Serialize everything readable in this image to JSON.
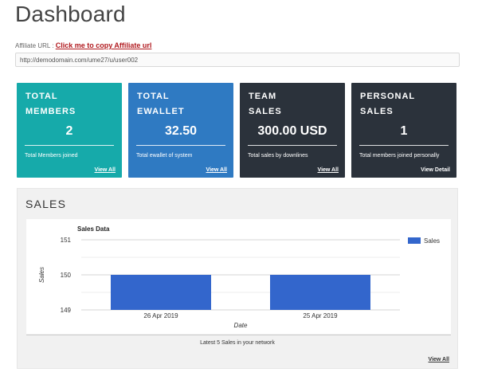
{
  "header": {
    "title": "Dashboard"
  },
  "affiliate": {
    "label": "Affiliate URL :",
    "copy_link": "Click me to copy Affiliate url",
    "url_value": "http://demodomain.com/ume27/u/user002"
  },
  "cards": [
    {
      "title_line1": "TOTAL",
      "title_line2": "MEMBERS",
      "value": "2",
      "desc": "Total Members joined",
      "link": "View All",
      "color": "#16aaaa"
    },
    {
      "title_line1": "TOTAL",
      "title_line2": "EWALLET",
      "value": "32.50",
      "desc": "Total ewallet of system",
      "link": "View All",
      "color": "#2f7ac2"
    },
    {
      "title_line1": "TEAM",
      "title_line2": "SALES",
      "value": "300.00 USD",
      "desc": "Total sales by downlines",
      "link": "View All",
      "color": "#2b323b"
    },
    {
      "title_line1": "PERSONAL",
      "title_line2": "SALES",
      "value": "1",
      "desc": "Total members joined personally",
      "link": "View Detail",
      "color": "#2b323b"
    }
  ],
  "sales_panel": {
    "heading": "SALES",
    "caption": "Latest 5 Sales in your network",
    "link": "View All"
  },
  "chart_data": {
    "type": "bar",
    "title": "Sales Data",
    "xlabel": "Date",
    "ylabel": "Sales",
    "categories": [
      "26 Apr 2019",
      "25 Apr 2019"
    ],
    "series": [
      {
        "name": "Sales",
        "values": [
          150,
          150
        ],
        "color": "#3366cc"
      }
    ],
    "ylim": [
      149,
      151
    ],
    "yticks": [
      "149",
      "150",
      "151"
    ],
    "legend": "right",
    "grid": true
  }
}
